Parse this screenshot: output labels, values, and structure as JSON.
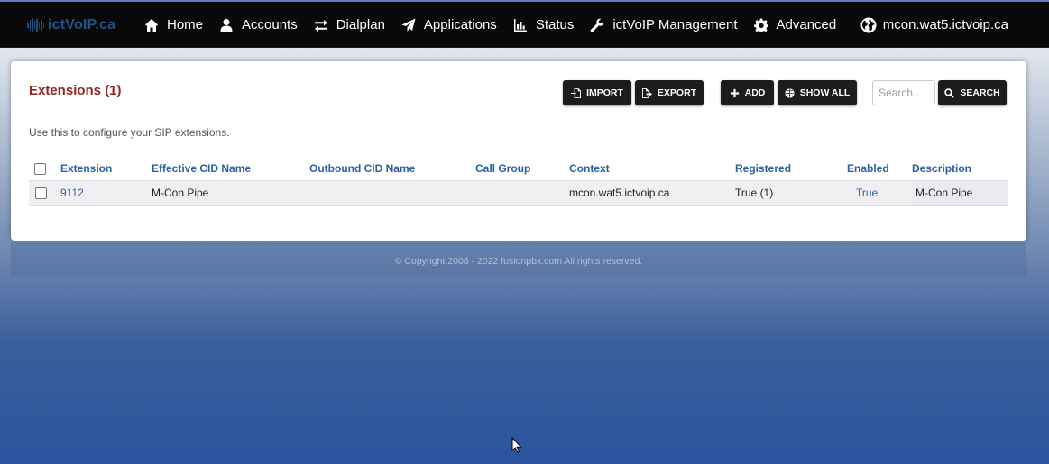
{
  "brand": {
    "name": "ictVoIP.ca"
  },
  "nav": {
    "items": [
      {
        "label": "Home",
        "icon": "home-icon"
      },
      {
        "label": "Accounts",
        "icon": "user-icon"
      },
      {
        "label": "Dialplan",
        "icon": "exchange-icon"
      },
      {
        "label": "Applications",
        "icon": "paper-plane-icon"
      },
      {
        "label": "Status",
        "icon": "bar-chart-icon"
      },
      {
        "label": "ictVoIP Management",
        "icon": "wrench-icon"
      },
      {
        "label": "Advanced",
        "icon": "gear-icon"
      }
    ],
    "domain": "mcon.wat5.ictvoip.ca"
  },
  "panel": {
    "title": "Extensions (1)",
    "description": "Use this to configure your SIP extensions.",
    "buttons": {
      "import": "IMPORT",
      "export": "EXPORT",
      "add": "ADD",
      "show_all": "SHOW ALL",
      "search": "SEARCH"
    },
    "search_placeholder": "Search..."
  },
  "table": {
    "headers": [
      "Extension",
      "Effective CID Name",
      "Outbound CID Name",
      "Call Group",
      "Context",
      "Registered",
      "Enabled",
      "Description"
    ],
    "rows": [
      {
        "extension": "9112",
        "effective_cid_name": "M-Con Pipe",
        "outbound_cid_name": "",
        "call_group": "",
        "context": "mcon.wat5.ictvoip.ca",
        "registered": "True (1)",
        "enabled": "True",
        "description": "M-Con Pipe"
      }
    ]
  },
  "footer": {
    "copyright": "© Copyright 2008 - 2022 fusionpbx.com All rights reserved."
  },
  "colors": {
    "navbar": "#090909",
    "title": "#952424",
    "link": "#2b61a7",
    "button": "#1c1c1c"
  }
}
